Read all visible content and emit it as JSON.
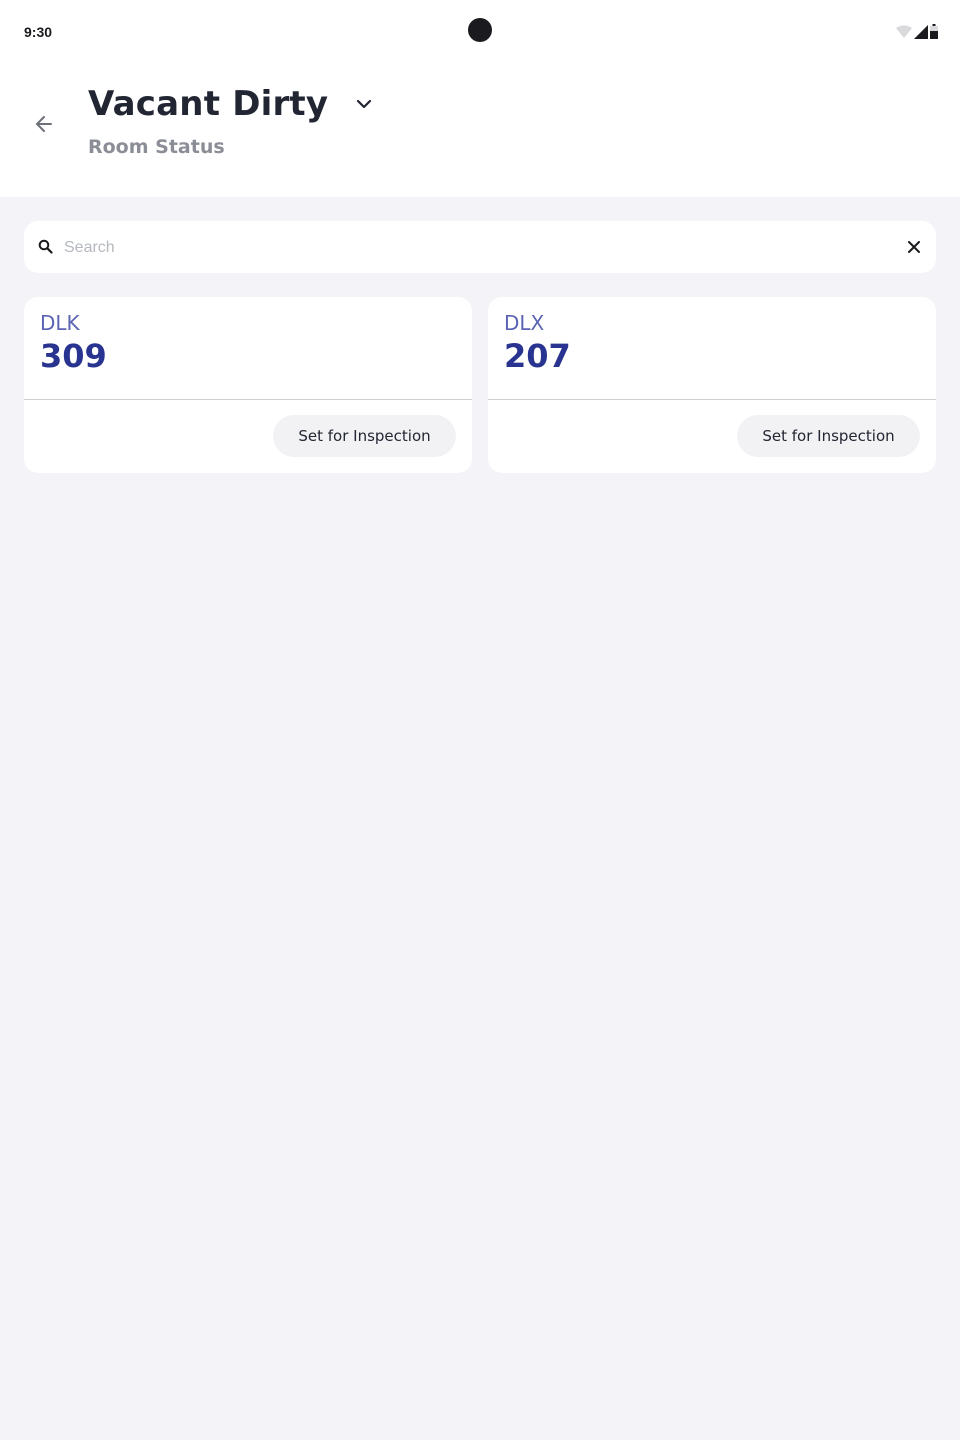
{
  "status_bar": {
    "time": "9:30",
    "icons": [
      "wifi-icon",
      "signal-icon",
      "battery-icon"
    ]
  },
  "header": {
    "title": "Vacant Dirty",
    "subtitle": "Room Status",
    "back_icon": "arrow-back-icon",
    "dropdown_icon": "chevron-down-icon"
  },
  "search": {
    "placeholder": "Search",
    "value": "",
    "icon": "search-icon",
    "clear_icon": "close-icon"
  },
  "rooms": [
    {
      "type": "DLK",
      "number": "309",
      "action_label": "Set for Inspection"
    },
    {
      "type": "DLX",
      "number": "207",
      "action_label": "Set for Inspection"
    }
  ],
  "colors": {
    "background": "#f3f3f8",
    "room_type": "#5c64b3",
    "room_number": "#28348f",
    "title": "#222633",
    "subtitle": "#8b8e96"
  }
}
